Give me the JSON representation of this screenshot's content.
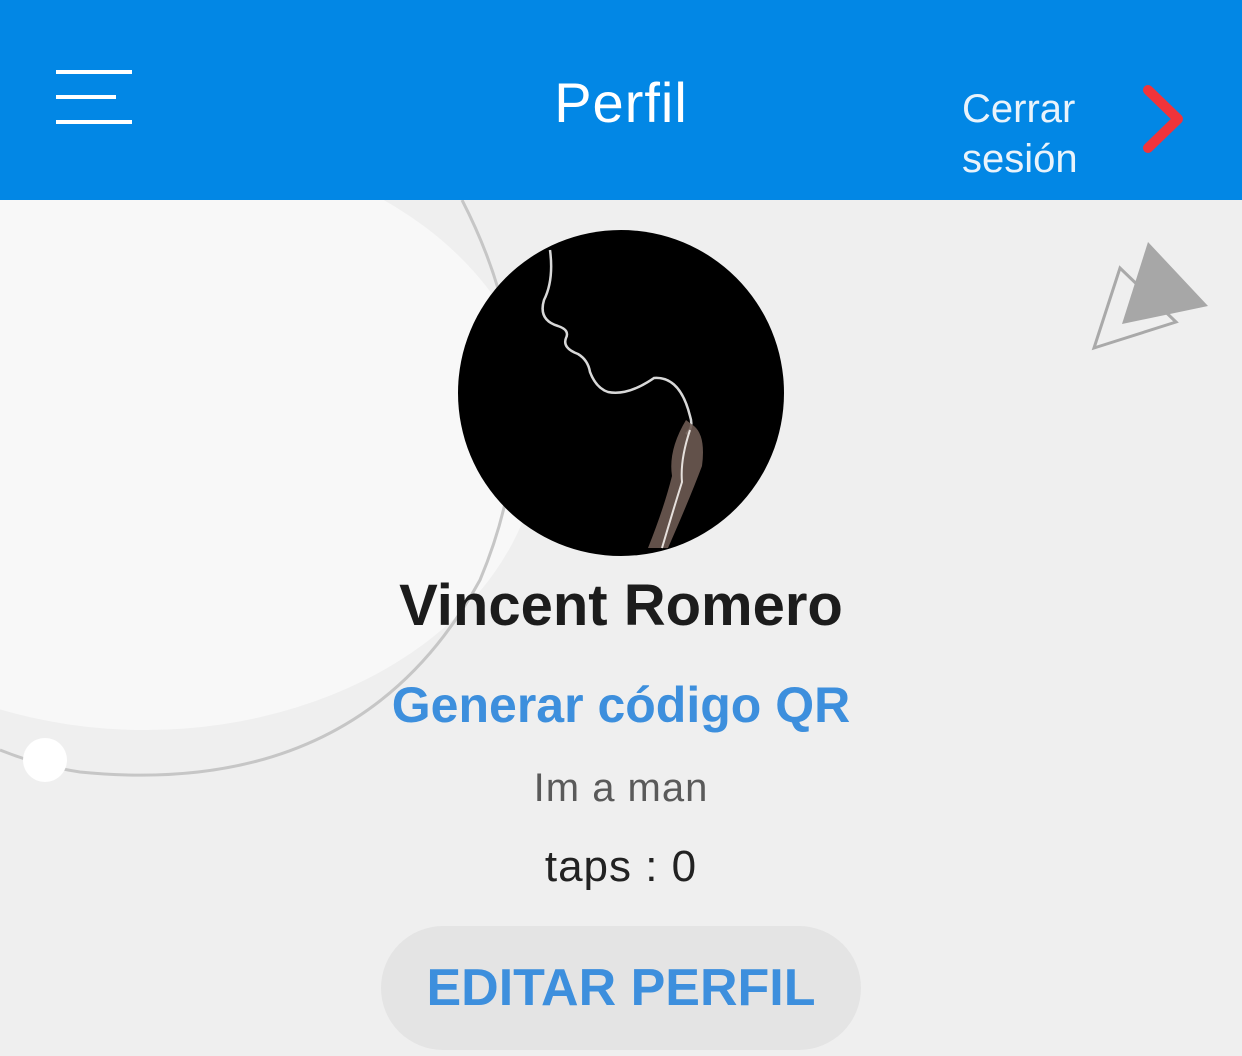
{
  "header": {
    "title": "Perfil",
    "logout_label": "Cerrar sesión",
    "menu_icon": "hamburger-menu-icon",
    "logout_icon": "chevron-right-icon",
    "background_color": "#0287e5",
    "chevron_color": "#f0343a"
  },
  "profile": {
    "name": "Vincent Romero",
    "qr_link": "Generar código QR",
    "bio": "Im a man",
    "taps_text": "taps : 0",
    "edit_button": "EDITAR PERFIL",
    "accent_color": "#3d8fdd"
  }
}
